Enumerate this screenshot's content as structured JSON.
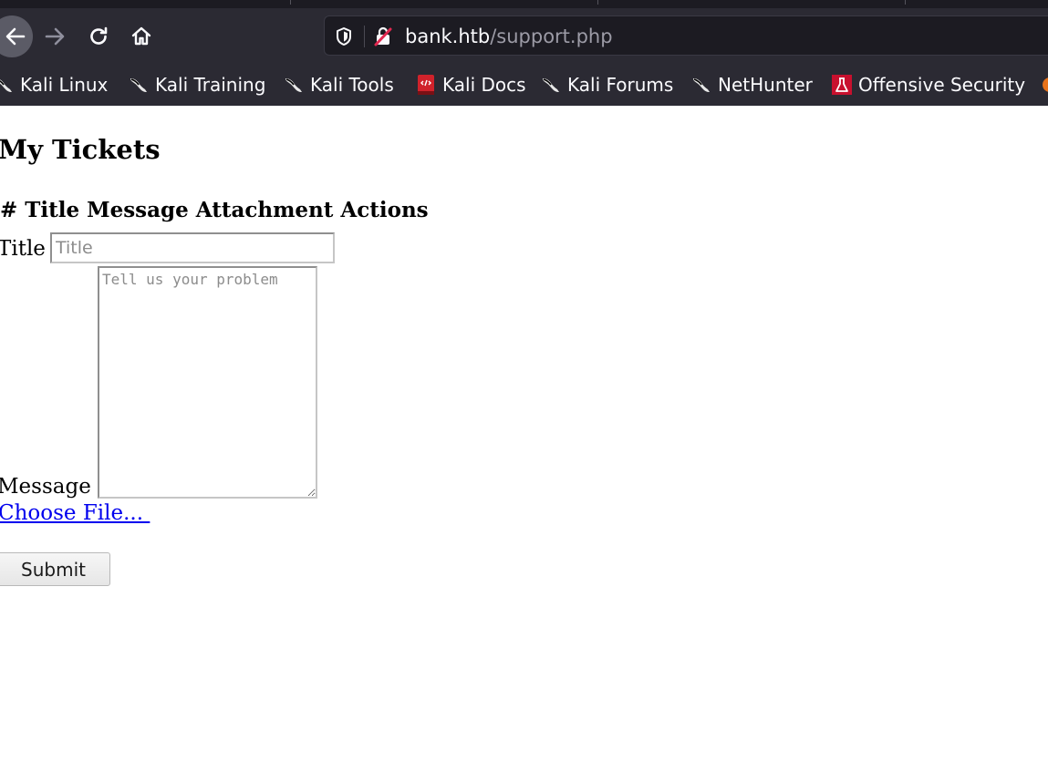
{
  "browser": {
    "url_host": "bank.htb",
    "url_path": "/support.php",
    "bookmarks": [
      {
        "label": "Kali Linux",
        "icon": "kali-dragon-icon"
      },
      {
        "label": "Kali Training",
        "icon": "kali-dragon-icon"
      },
      {
        "label": "Kali Tools",
        "icon": "kali-dragon-icon"
      },
      {
        "label": "Kali Docs",
        "icon": "kali-docs-icon"
      },
      {
        "label": "Kali Forums",
        "icon": "kali-dragon-icon"
      },
      {
        "label": "NetHunter",
        "icon": "kali-dragon-icon"
      },
      {
        "label": "Offensive Security",
        "icon": "offsec-icon"
      }
    ],
    "colors": {
      "toolbar": "#2b2a33",
      "urlbar": "#1c1b22",
      "insecure_lock": "#e22850"
    }
  },
  "page": {
    "heading": "My Tickets",
    "table_header": "# Title Message Attachment Actions",
    "form": {
      "title_label": "Title",
      "title_placeholder": "Title",
      "message_label": "Message",
      "message_placeholder": "Tell us your problem",
      "file_link": "Choose File... ",
      "submit_label": "Submit"
    }
  }
}
